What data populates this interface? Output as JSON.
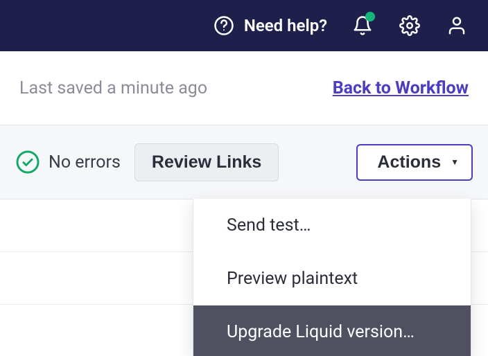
{
  "topbar": {
    "help_label": "Need help?"
  },
  "subbar": {
    "last_saved": "Last saved a minute ago",
    "back_link": "Back to Workflow"
  },
  "toolbar": {
    "errors_label": "No errors",
    "review_label": "Review Links",
    "actions_label": "Actions"
  },
  "actions_menu": {
    "items": [
      "Send test…",
      "Preview plaintext",
      "Upgrade Liquid version…"
    ]
  }
}
